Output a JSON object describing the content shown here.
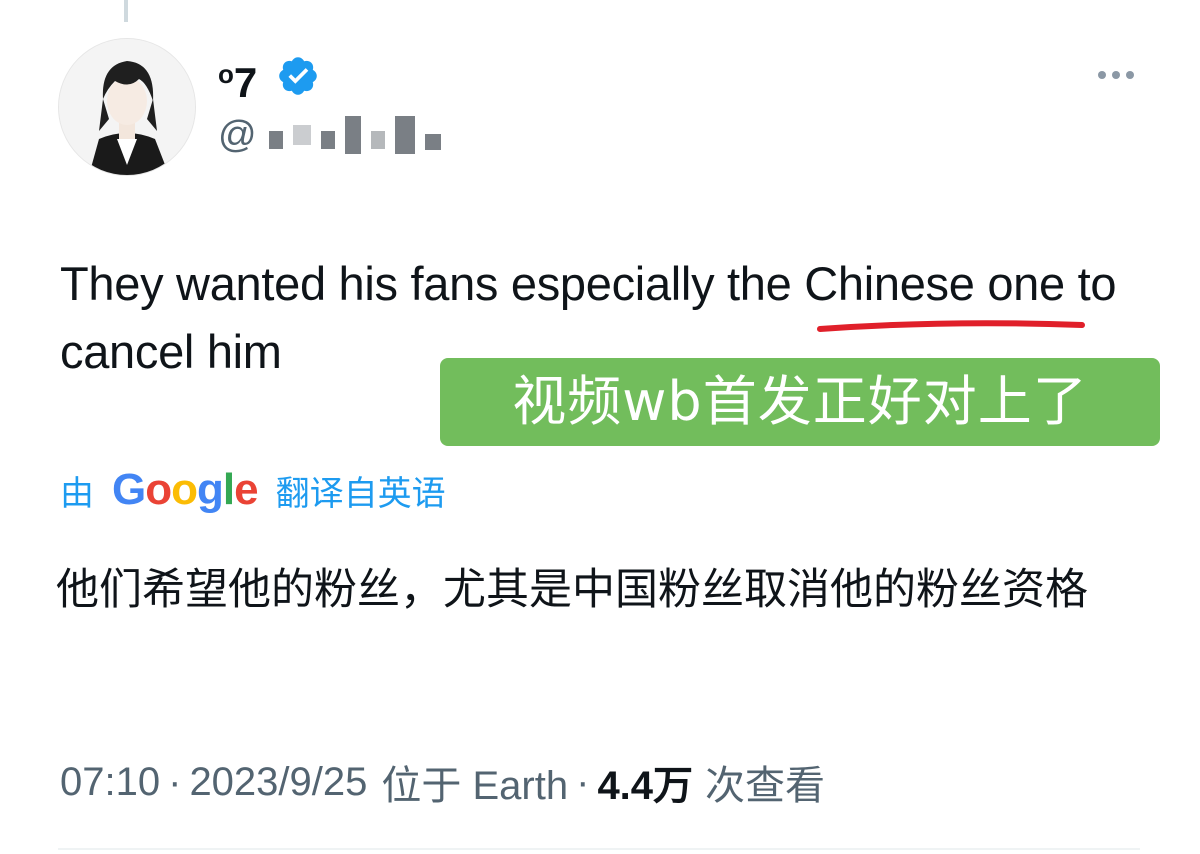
{
  "author": {
    "display_name_sup": "o",
    "display_name": "7",
    "handle_prefix": "@",
    "verified_icon": "verified-badge-icon"
  },
  "tweet": {
    "text": "They wanted his fans especially the Chinese one to cancel him"
  },
  "overlay": {
    "caption": "视频wb首发正好对上了",
    "background": "#72bd5c"
  },
  "translation": {
    "prefix": "由",
    "provider": "Google",
    "suffix": "翻译自英语",
    "text": "他们希望他的粉丝，尤其是中国粉丝取消他的粉丝资格"
  },
  "meta": {
    "time": "07:10",
    "date": "2023/9/25",
    "location": "位于 Earth",
    "views_count": "4.4万",
    "views_label": "次查看"
  },
  "colors": {
    "accent": "#1d9bf0",
    "underline": "#e0202a",
    "secondary_text": "#536471"
  }
}
